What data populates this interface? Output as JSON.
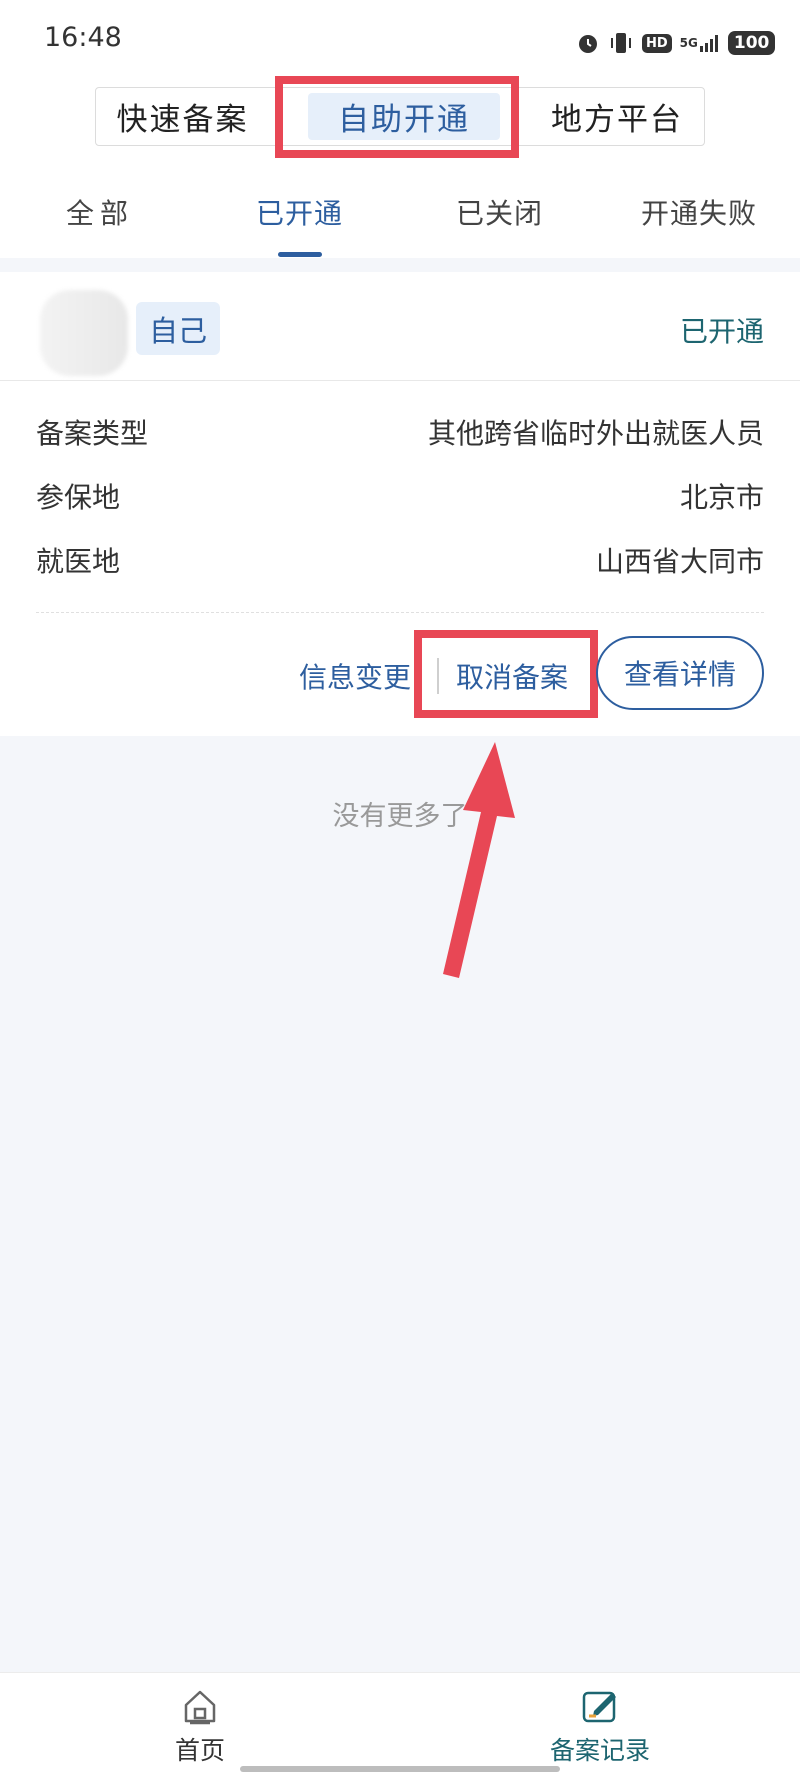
{
  "status_bar": {
    "time": "16:48",
    "network": "5G",
    "battery": "100",
    "hd": "HD"
  },
  "segmented": [
    "快速备案",
    "自助开通",
    "地方平台"
  ],
  "tabs": [
    "全部",
    "已开通",
    "已关闭",
    "开通失败"
  ],
  "card": {
    "tag": "自己",
    "status": "已开通",
    "rows": [
      {
        "label": "备案类型",
        "value": "其他跨省临时外出就医人员"
      },
      {
        "label": "参保地",
        "value": "北京市"
      },
      {
        "label": "就医地",
        "value": "山西省大同市"
      }
    ],
    "actions": {
      "change": "信息变更",
      "cancel": "取消备案",
      "detail": "查看详情"
    }
  },
  "no_more": "没有更多了",
  "bottom_nav": [
    {
      "label": "首页",
      "icon": "home-icon"
    },
    {
      "label": "备案记录",
      "icon": "record-edit-icon"
    }
  ],
  "colors": {
    "accent": "#2d5e9f",
    "teal": "#1d6570",
    "highlight": "#e84755"
  }
}
